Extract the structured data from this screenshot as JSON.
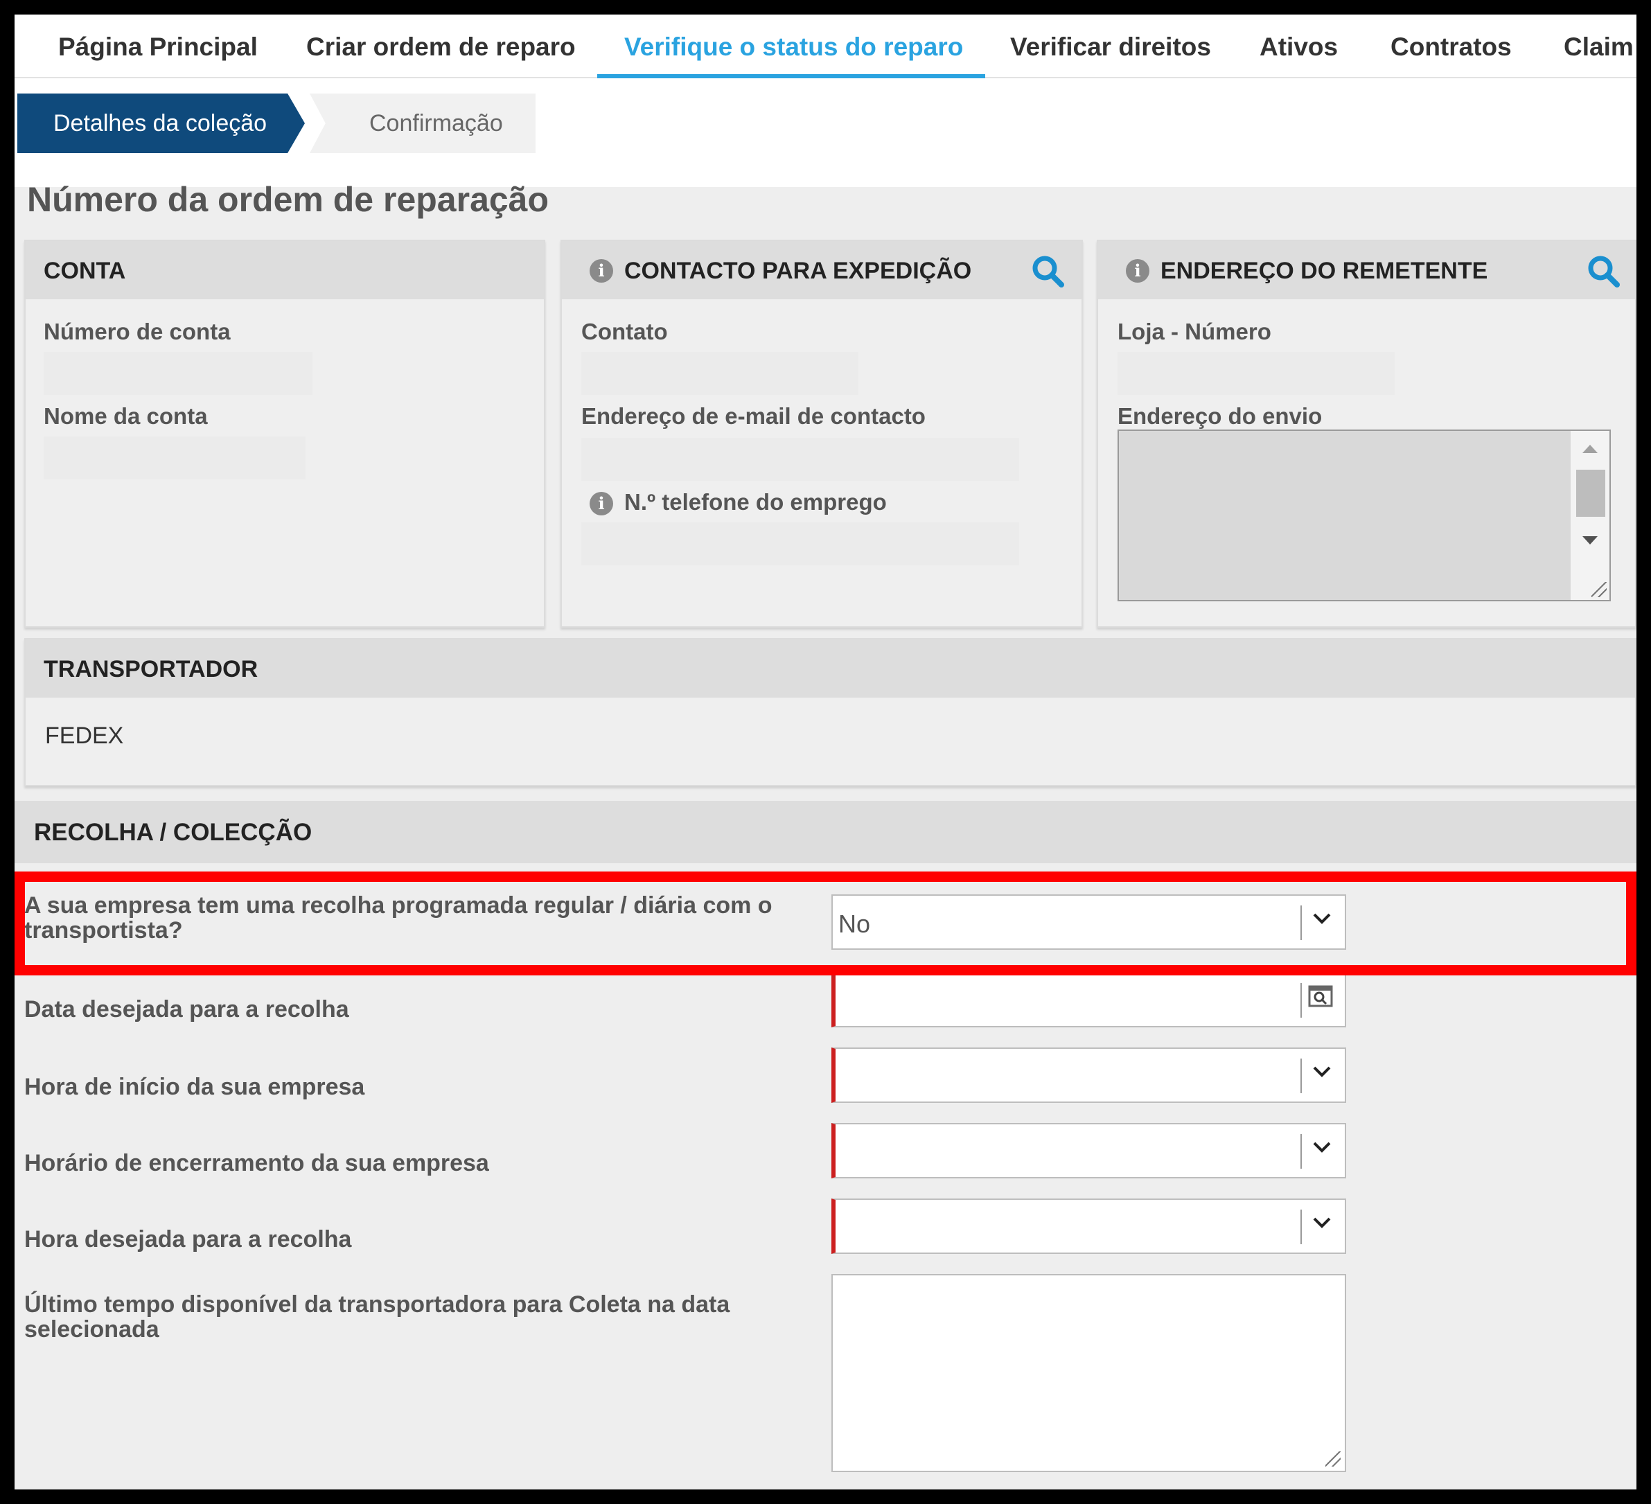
{
  "nav": {
    "items": [
      {
        "label": "Página Principal"
      },
      {
        "label": "Criar ordem de reparo"
      },
      {
        "label": "Verifique o status do reparo"
      },
      {
        "label": "Verificar direitos"
      },
      {
        "label": "Ativos"
      },
      {
        "label": "Contratos"
      },
      {
        "label": "Claim"
      }
    ],
    "active_index": 2,
    "accent_color": "#2aa3e0"
  },
  "steps": [
    {
      "label": "Detalhes da coleção",
      "state": "active",
      "color": "#0f4a7c"
    },
    {
      "label": "Confirmação",
      "state": "inactive"
    }
  ],
  "page_title": "Número da ordem de reparação",
  "conta": {
    "title": "CONTA",
    "fields": [
      {
        "label": "Número de conta",
        "value": ""
      },
      {
        "label": "Nome da conta",
        "value": ""
      }
    ]
  },
  "contacto": {
    "title": "CONTACTO PARA EXPEDIÇÃO",
    "icons": [
      "info-icon",
      "search-icon"
    ],
    "fields": [
      {
        "label": "Contato",
        "value": ""
      },
      {
        "label": "Endereço de e-mail de contacto",
        "value": ""
      },
      {
        "label": "N.º telefone do emprego",
        "value": "",
        "icon": "info-icon"
      }
    ]
  },
  "remetente": {
    "title": "ENDEREÇO DO REMETENTE",
    "icons": [
      "info-icon",
      "search-icon"
    ],
    "fields": [
      {
        "label": "Loja - Número",
        "value": ""
      },
      {
        "label": "Endereço do envio",
        "value": ""
      }
    ]
  },
  "transportador": {
    "title": "TRANSPORTADOR",
    "value": "FEDEX"
  },
  "recolha": {
    "title": "RECOLHA / COLECÇÃO",
    "questions": [
      {
        "label": "A sua empresa tem uma recolha programada regular / diária com o transportista?",
        "value": "No",
        "control": "select",
        "icon": "chevron-down-icon",
        "highlighted": true
      },
      {
        "label": "Data desejada para a recolha",
        "value": "",
        "control": "date",
        "icon": "calendar-search-icon",
        "required": true
      },
      {
        "label": "Hora de início da sua empresa",
        "value": "",
        "control": "select",
        "icon": "chevron-down-icon",
        "required": true
      },
      {
        "label": "Horário de encerramento da sua empresa",
        "value": "",
        "control": "select",
        "icon": "chevron-down-icon",
        "required": true
      },
      {
        "label": "Hora desejada para a recolha",
        "value": "",
        "control": "select",
        "icon": "chevron-down-icon",
        "required": true
      },
      {
        "label": "Último tempo disponível da transportadora para Coleta na data selecionada",
        "value": "",
        "control": "textarea"
      }
    ]
  },
  "colors": {
    "highlight": "#ff0000",
    "required_marker": "#cc1f1f",
    "search_icon": "#1a8fcf"
  }
}
